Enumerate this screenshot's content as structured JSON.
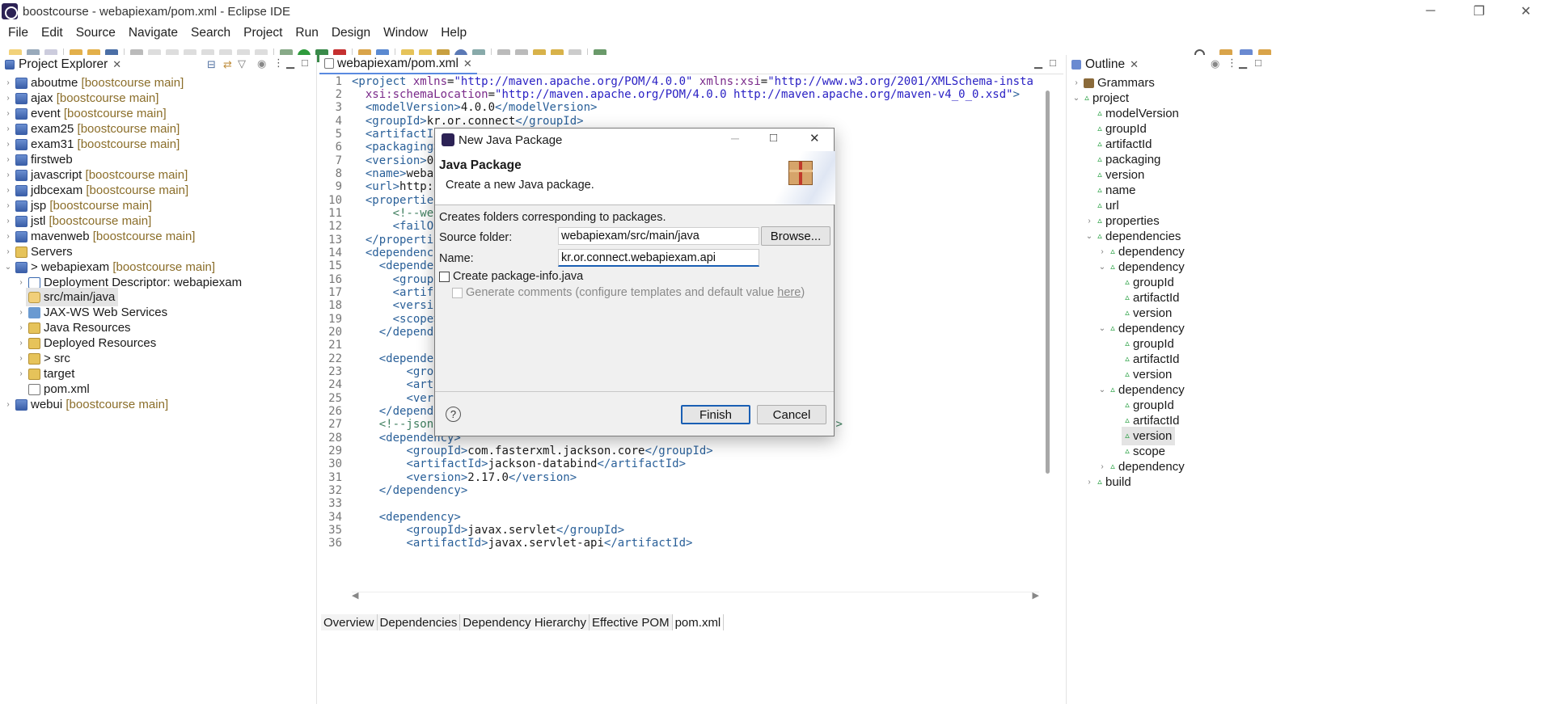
{
  "window": {
    "title": "boostcourse - webapiexam/pom.xml - Eclipse IDE",
    "minimize": "─",
    "restore": "❐",
    "close": "✕"
  },
  "menu": [
    "File",
    "Edit",
    "Source",
    "Navigate",
    "Search",
    "Project",
    "Run",
    "Design",
    "Window",
    "Help"
  ],
  "project_explorer": {
    "title": "Project Explorer",
    "items": [
      {
        "name": "aboutme",
        "branch": "[boostcourse main]"
      },
      {
        "name": "ajax",
        "branch": "[boostcourse main]"
      },
      {
        "name": "event",
        "branch": "[boostcourse main]"
      },
      {
        "name": "exam25",
        "branch": "[boostcourse main]"
      },
      {
        "name": "exam31",
        "branch": "[boostcourse main]"
      },
      {
        "name": "firstweb",
        "branch": ""
      },
      {
        "name": "javascript",
        "branch": "[boostcourse main]"
      },
      {
        "name": "jdbcexam",
        "branch": "[boostcourse main]"
      },
      {
        "name": "jsp",
        "branch": "[boostcourse main]"
      },
      {
        "name": "jstl",
        "branch": "[boostcourse main]"
      },
      {
        "name": "mavenweb",
        "branch": "[boostcourse main]"
      },
      {
        "name": "Servers",
        "branch": ""
      },
      {
        "name": "> webapiexam",
        "branch": "[boostcourse main]"
      },
      {
        "name": "Deployment Descriptor: webapiexam",
        "branch": ""
      },
      {
        "name": "src/main/java",
        "branch": ""
      },
      {
        "name": "JAX-WS Web Services",
        "branch": ""
      },
      {
        "name": "Java Resources",
        "branch": ""
      },
      {
        "name": "Deployed Resources",
        "branch": ""
      },
      {
        "name": "> src",
        "branch": ""
      },
      {
        "name": "target",
        "branch": ""
      },
      {
        "name": "pom.xml",
        "branch": ""
      },
      {
        "name": "webui",
        "branch": "[boostcourse main]"
      }
    ]
  },
  "editor": {
    "tab": "webapiexam/pom.xml",
    "bottom_tabs": [
      "Overview",
      "Dependencies",
      "Dependency Hierarchy",
      "Effective POM",
      "pom.xml"
    ],
    "line_numbers": [
      "1",
      "2",
      "3",
      "4",
      "5",
      "6",
      "7",
      "8",
      "9",
      "10",
      "11",
      "12",
      "13",
      "14",
      "15",
      "16",
      "17",
      "18",
      "19",
      "20",
      "21",
      "22",
      "23",
      "24",
      "25",
      "26",
      "27",
      "28",
      "29",
      "30",
      "31",
      "32",
      "33",
      "34",
      "35",
      "36"
    ]
  },
  "outline": {
    "title": "Outline",
    "items": [
      "Grammars",
      "project",
      "modelVersion",
      "groupId",
      "artifactId",
      "packaging",
      "version",
      "name",
      "url",
      "properties",
      "dependencies",
      "dependency",
      "dependency",
      "groupId",
      "artifactId",
      "version",
      "dependency",
      "groupId",
      "artifactId",
      "version",
      "dependency",
      "groupId",
      "artifactId",
      "version",
      "scope",
      "dependency",
      "build"
    ]
  },
  "dialog": {
    "title": "New Java Package",
    "header_title": "Java Package",
    "header_desc": "Create a new Java package.",
    "info": "Creates folders corresponding to packages.",
    "source_folder_label": "Source folder:",
    "source_folder_value": "webapiexam/src/main/java",
    "browse": "Browse...",
    "name_label": "Name:",
    "name_value": "kr.or.connect.webapiexam.api",
    "create_pkg_info": "Create package-info.java",
    "gen_comments": "Generate comments (configure templates and default value ",
    "gen_comments_link": "here",
    "gen_comments_end": ")",
    "help": "?",
    "finish": "Finish",
    "cancel": "Cancel"
  }
}
